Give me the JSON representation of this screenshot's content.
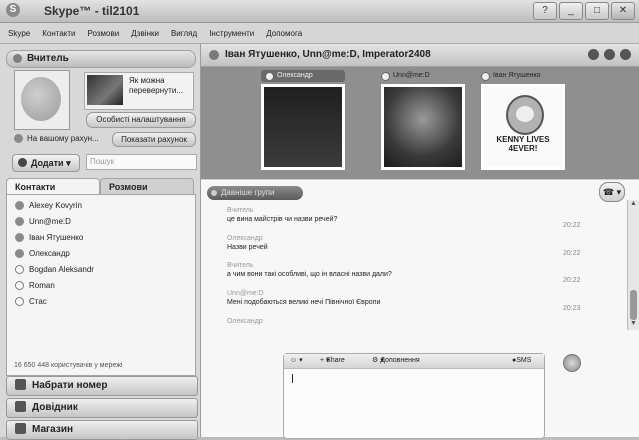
{
  "window": {
    "title": "Skype™ - til2101",
    "buttons": [
      "?",
      "_",
      "□",
      "✕"
    ]
  },
  "menu": [
    "Skype",
    "Контакти",
    "Розмови",
    "Дзвінки",
    "Вигляд",
    "Інструменти",
    "Допомога"
  ],
  "profile": {
    "name": "Вчитель",
    "mood": "Як можна перевернути...",
    "settings_button": "Особисті налаштування",
    "credit_text": "На вашому рахун...",
    "show_account_button": "Показати рахунок"
  },
  "add_button": "Додати",
  "search_placeholder": "Пошук",
  "tabs": [
    "Контакти",
    "Розмови"
  ],
  "contacts": [
    {
      "name": "Alexey Kovyrin",
      "online": true
    },
    {
      "name": "Unn@me:D",
      "online": true
    },
    {
      "name": "Іван Ятушенко",
      "online": true
    },
    {
      "name": "Олександр",
      "online": true
    },
    {
      "name": "Bogdan Aleksandr",
      "online": false
    },
    {
      "name": "Roman",
      "online": false
    },
    {
      "name": "Стас",
      "online": false
    }
  ],
  "user_count": "16 650 448 користувачів у мережі",
  "bottom_buttons": [
    "Набрати номер",
    "Довідник",
    "Магазин"
  ],
  "conversation": {
    "title": "Іван Ятушенко, Unn@me:D, Imperator2408",
    "participants": [
      "Олександр",
      "Unn@me:D",
      "Іван Ятушенко"
    ],
    "poster_text": "KENNY LIVES 4EVER!",
    "history_button": "Давніше групи",
    "messages": [
      {
        "sender": "Вчитель",
        "text": "це вина майстрів чи назви речей?",
        "time": "20:22"
      },
      {
        "sender": "Олександр",
        "text": "Назви речей",
        "time": "20:22"
      },
      {
        "sender": "Вчитель",
        "text": "а чим вони такі особливі, що ін власні назви дали?",
        "time": "20:22"
      },
      {
        "sender": "Unn@me:D",
        "text": "Мені подобаються великі нечі Північної Європи",
        "time": "20:23"
      },
      {
        "sender": "Олександр",
        "text": "",
        "time": ""
      }
    ],
    "compose": {
      "share_label": "Share",
      "addons_label": "Доповнення",
      "sms_label": "SMS"
    }
  }
}
